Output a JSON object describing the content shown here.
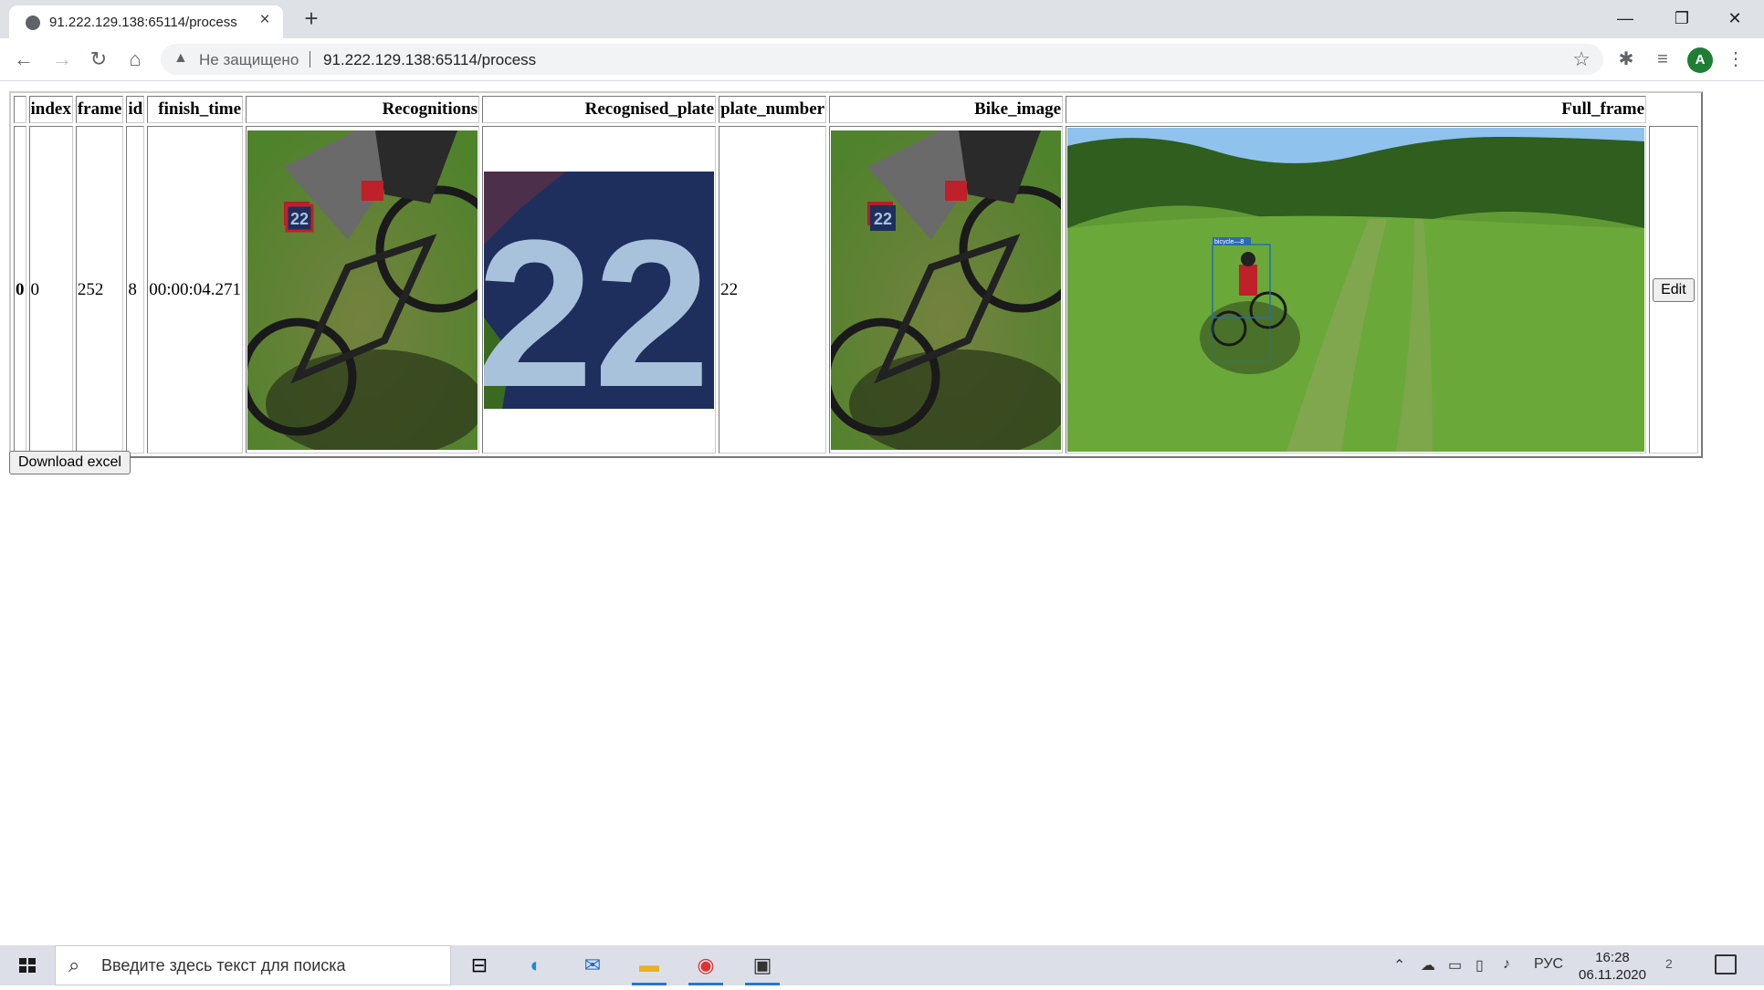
{
  "browser": {
    "tab_title": "91.222.129.138:65114/process",
    "security_label": "Не защищено",
    "url": "91.222.129.138:65114/process",
    "profile_initial": "A"
  },
  "table": {
    "columns": [
      "",
      "index",
      "frame",
      "id",
      "finish_time",
      "Recognitions",
      "Recognised_plate",
      "plate_number",
      "Bike_image",
      "Full_frame",
      ""
    ],
    "rows": [
      {
        "row_label": "0",
        "index": "0",
        "frame": "252",
        "id": "8",
        "finish_time": "00:00:04.271",
        "recognised_plate_text": "22",
        "plate_number": "22",
        "detection_label": "bicycle—8",
        "edit_label": "Edit"
      }
    ]
  },
  "download_button_label": "Download excel",
  "taskbar": {
    "search_placeholder": "Введите здесь текст для поиска",
    "language": "РУС",
    "time": "16:28",
    "date": "06.11.2020",
    "notification_count": "2"
  },
  "colors": {
    "grass": "#5f9a34",
    "plate_blue": "#1e2f5e",
    "plate_digit": "#a9c2dc",
    "sky": "#8fc3ee",
    "chrome_tabbar": "#dee1e6",
    "taskbar": "#dcdfe8"
  }
}
